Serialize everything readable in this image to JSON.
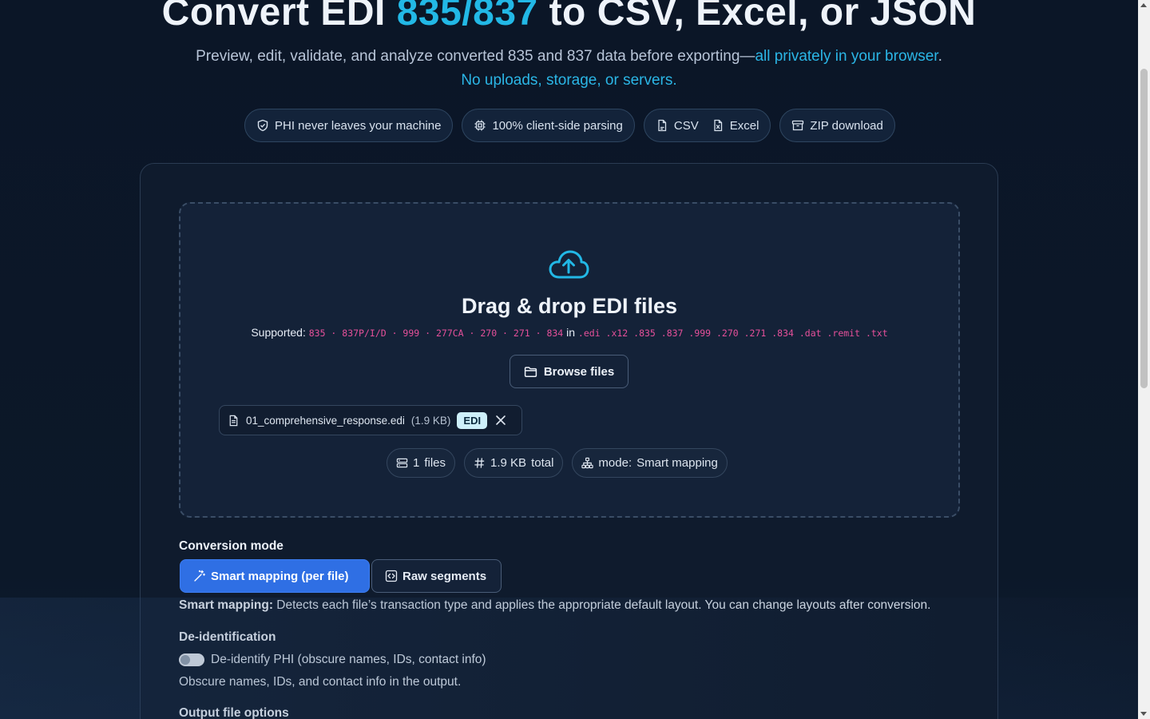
{
  "hero": {
    "title_part1": "Convert EDI ",
    "title_accent": "835/837",
    "title_part2": " to CSV, Excel, or JSON",
    "subtitle_plain": "Preview, edit, validate, and analyze converted 835 and 837 data before exporting—",
    "subtitle_accent_1": "all privately in your browser",
    "subtitle_period": ".",
    "subtitle_accent_2": "No uploads, storage, or servers."
  },
  "pills": [
    {
      "icon": "shield-check-icon",
      "label": "PHI never leaves your machine"
    },
    {
      "icon": "cpu-chip-icon",
      "label": "100% client-side parsing"
    },
    {
      "icon": "file-icon",
      "label": "CSV"
    },
    {
      "icon": "excel-file-icon",
      "label": "Excel"
    },
    {
      "icon": "archive-box-icon",
      "label": "ZIP download"
    }
  ],
  "dropzone": {
    "icon": "cloud-upload-icon",
    "title": "Drag & drop EDI files",
    "supported_label": "Supported:",
    "transaction_types": "835 · 837P/I/D · 999 · 277CA · 270 · 271 · 834",
    "in_word": "in",
    "extensions": ".edi .x12 .835 .837 .999 .270 .271 .834 .dat .remit .txt",
    "browse_label": "Browse files"
  },
  "file": {
    "name": "01_comprehensive_response.edi",
    "size": "(1.9 KB)",
    "badge": "EDI"
  },
  "stats": [
    {
      "icon": "stack-icon",
      "value": "1",
      "label": "files"
    },
    {
      "icon": "hash-icon",
      "value": "1.9 KB",
      "label": "total"
    },
    {
      "icon": "sitemap-icon",
      "value": "mode:",
      "label": "Smart mapping"
    }
  ],
  "conversion": {
    "heading": "Conversion mode",
    "modes": [
      {
        "icon": "magic-wand-icon",
        "label": "Smart mapping (per file)",
        "active": true
      },
      {
        "icon": "code-icon",
        "label": "Raw segments",
        "active": false
      }
    ],
    "desc_bold": "Smart mapping:",
    "desc_text": " Detects each file’s transaction type and applies the appropriate default layout. You can change layouts after conversion."
  },
  "deid": {
    "heading": "De-identification",
    "toggle_on": false,
    "toggle_label": "De-identify PHI (obscure names, IDs, contact info)",
    "help": "Obscure names, IDs, and contact info in the output."
  },
  "output": {
    "heading": "Output file options"
  },
  "colors": {
    "accent": "#22b8e6",
    "primary_button": "#2f6fe4",
    "code_pink": "#e5509a",
    "background": "#0b1627"
  }
}
